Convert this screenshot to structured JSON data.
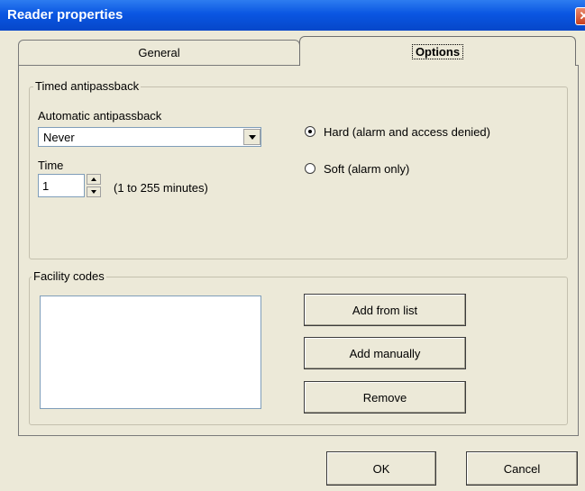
{
  "window": {
    "title": "Reader properties",
    "close_glyph": "✕"
  },
  "tabs": [
    {
      "label": "General",
      "active": false
    },
    {
      "label": "Options",
      "active": true
    }
  ],
  "timed_antipassback": {
    "group_label": "Timed antipassback",
    "auto_label": "Automatic antipassback",
    "auto_value": "Never",
    "time_label": "Time",
    "time_value": "1",
    "time_hint": "(1 to 255 minutes)",
    "radio_hard": {
      "label": "Hard (alarm and access denied)",
      "checked": true
    },
    "radio_soft": {
      "label": "Soft (alarm only)",
      "checked": false
    }
  },
  "facility_codes": {
    "group_label": "Facility codes",
    "items": [],
    "add_from_list": "Add from list",
    "add_manually": "Add manually",
    "remove": "Remove"
  },
  "footer": {
    "ok": "OK",
    "cancel": "Cancel"
  },
  "icons": {
    "dropdown": "chevron-down-icon",
    "spin_up": "arrow-up-icon",
    "spin_down": "arrow-down-icon",
    "close": "close-icon"
  },
  "colors": {
    "titlebar": "#0a56e2",
    "face": "#ece9d8",
    "field_border": "#7f9db9"
  }
}
